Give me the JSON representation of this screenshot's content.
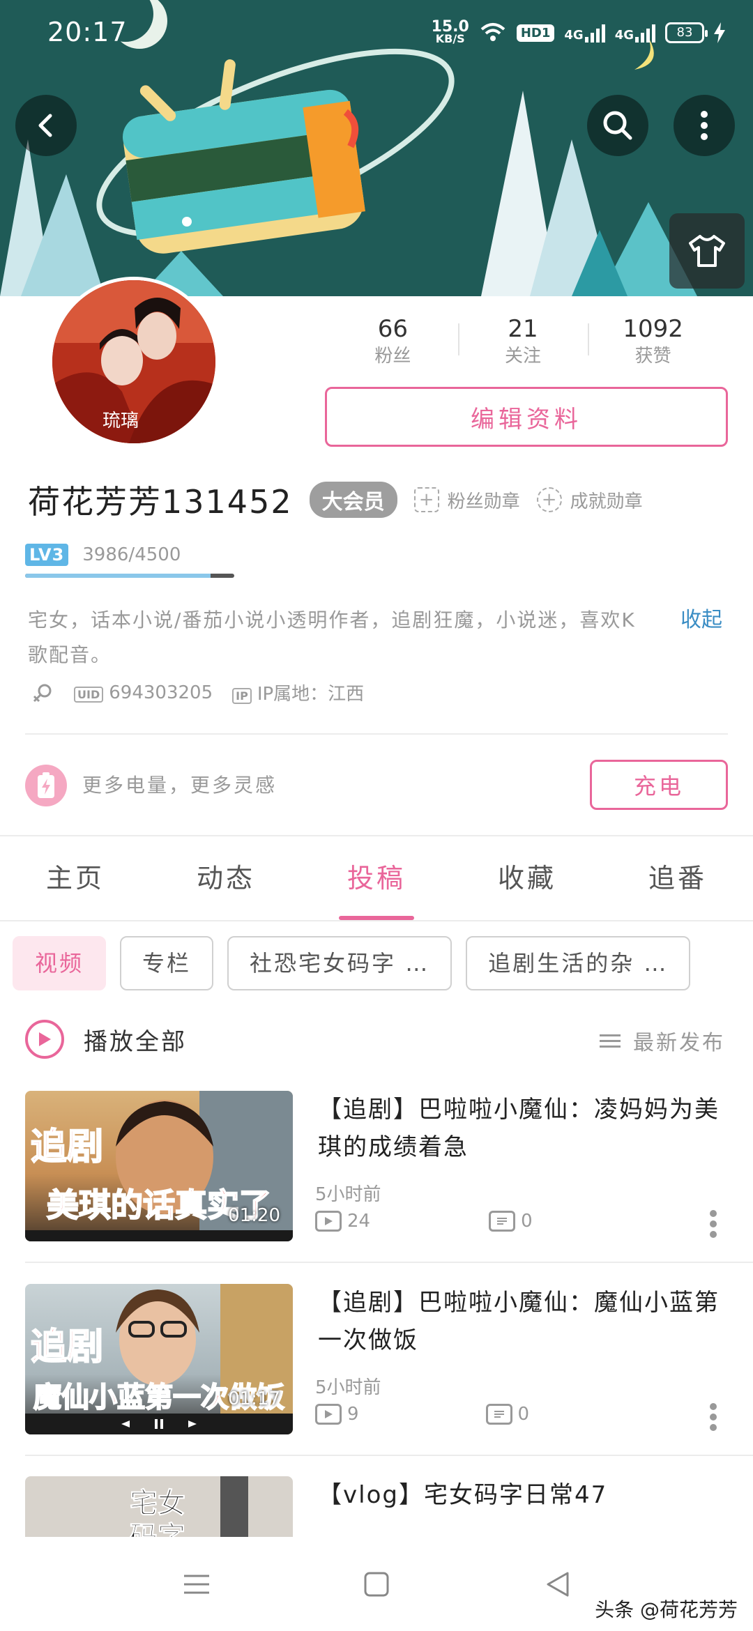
{
  "status_bar": {
    "time": "20:17",
    "net_speed": "15.0",
    "net_unit": "KB/S",
    "hd": "HD1",
    "signal1": "4G",
    "signal2": "4G",
    "battery": "83"
  },
  "header": {
    "back_icon": "chevron-left-icon",
    "search_icon": "search-icon",
    "more_icon": "more-vertical-icon",
    "skin_icon": "tshirt-icon"
  },
  "avatar": {
    "caption": "琉璃"
  },
  "stats": [
    {
      "num": "66",
      "label": "粉丝"
    },
    {
      "num": "21",
      "label": "关注"
    },
    {
      "num": "1092",
      "label": "获赞"
    }
  ],
  "edit_button": "编辑资料",
  "profile": {
    "username": "荷花芳芳131452",
    "vip": "大会员",
    "fan_medal": "粉丝勋章",
    "achievement_medal": "成就勋章",
    "level": "LV3",
    "exp": "3986/4500",
    "exp_progress": 0.886,
    "bio": "宅女，话本小说/番茄小说小透明作者，追剧狂魔，小说迷，喜欢K歌配音。",
    "bio_toggle": "收起",
    "uid_tag": "UID",
    "uid": "694303205",
    "ip_tag": "IP",
    "ip": "IP属地：江西"
  },
  "charge": {
    "text": "更多电量，更多灵感",
    "button": "充电"
  },
  "tabs": [
    {
      "label": "主页",
      "active": false
    },
    {
      "label": "动态",
      "active": false
    },
    {
      "label": "投稿",
      "active": true
    },
    {
      "label": "收藏",
      "active": false
    },
    {
      "label": "追番",
      "active": false
    }
  ],
  "chips": [
    {
      "label": "视频",
      "active": true
    },
    {
      "label": "专栏",
      "active": false
    },
    {
      "label": "社恐宅女码字 …",
      "active": false
    },
    {
      "label": "追剧生活的杂 …",
      "active": false
    }
  ],
  "play_all": "播放全部",
  "sort": "最新发布",
  "videos": [
    {
      "title": "【追剧】巴啦啦小魔仙：凌妈妈为美琪的成绩着急",
      "time": "5小时前",
      "plays": "24",
      "comments": "0",
      "duration": "01:20",
      "thumb_top": "追剧",
      "thumb_bottom": "美琪的话真实了"
    },
    {
      "title": "【追剧】巴啦啦小魔仙：魔仙小蓝第一次做饭",
      "time": "5小时前",
      "plays": "9",
      "comments": "0",
      "duration": "01:17",
      "thumb_top": "追剧",
      "thumb_bottom": "魔仙小蓝第一次做饭"
    },
    {
      "title": "【vlog】宅女码字日常47",
      "thumb_top": "宅女",
      "thumb_bottom": "码字"
    }
  ],
  "watermark": "头条 @荷花芳芳",
  "colors": {
    "accent": "#e9669a",
    "banner": "#1f5b57",
    "link": "#3a8dc4",
    "level": "#5fb6e6"
  }
}
